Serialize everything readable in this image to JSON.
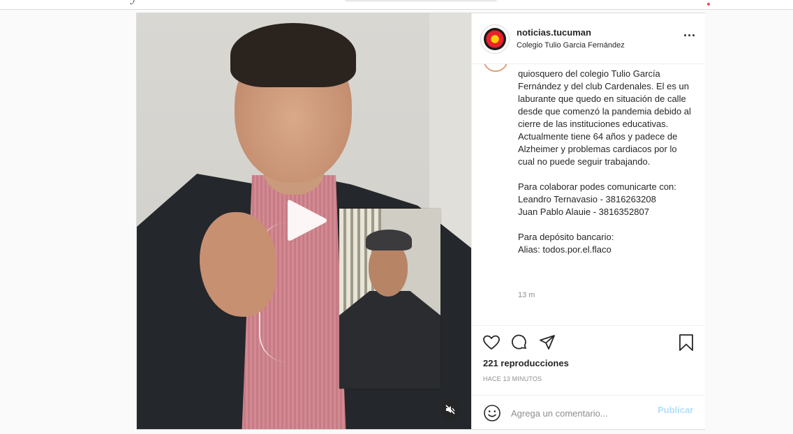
{
  "post": {
    "username": "noticias.tucuman",
    "location": "Colegio Tulio Garcia Fernández",
    "caption_lines": "quiosquero del colegio Tulio García Fernández y del club Cardenales. El es un laburante que quedo en situación de calle desde que comenzó la pandemia debido al cierre de las instituciones educativas. Actualmente tiene 64 años y padece de Alzheimer y problemas cardiacos por lo cual no puede seguir trabajando.\n\nPara colaborar podes comunicarte con:\nLeandro Ternavasio - 3816263208\nJuan Pablo Alauie - 3816352807\n\nPara depósito bancario:\nAlias: todos.por.el.flaco",
    "caption_time": "13 m",
    "views": "221 reproducciones",
    "posted_ago": "HACE 13 MINUTOS"
  },
  "comment": {
    "placeholder": "Agrega un comentario...",
    "publish_label": "Publicar"
  },
  "icons": {
    "more": "more-options-icon",
    "like": "heart-icon",
    "comment": "comment-icon",
    "share": "send-icon",
    "save": "bookmark-icon",
    "emoji": "emoji-icon",
    "play": "play-icon",
    "mute": "muted-speaker-icon"
  },
  "colors": {
    "publish_disabled": "#b2dffc",
    "text": "#262626",
    "secondary": "#8e8e8e",
    "notification": "#ed4956"
  }
}
